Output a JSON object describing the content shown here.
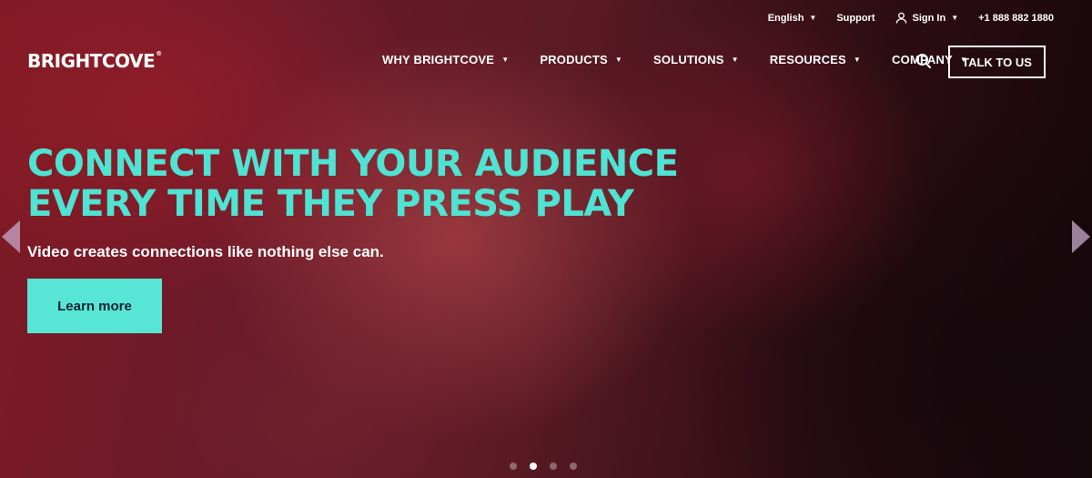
{
  "utility": {
    "language": "English",
    "support": "Support",
    "sign_in": "Sign In",
    "phone": "+1 888 882 1880"
  },
  "logo": {
    "text": "BRIGHTCOVE",
    "mark": "®"
  },
  "nav": {
    "items": [
      {
        "label": "WHY BRIGHTCOVE"
      },
      {
        "label": "PRODUCTS"
      },
      {
        "label": "SOLUTIONS"
      },
      {
        "label": "RESOURCES"
      },
      {
        "label": "COMPANY"
      }
    ],
    "cta": "TALK TO US",
    "search_icon": "search-icon"
  },
  "hero": {
    "headline_line1": "CONNECT WITH YOUR AUDIENCE",
    "headline_line2": "EVERY TIME THEY PRESS PLAY",
    "subhead": "Video creates connections like nothing else can.",
    "button": "Learn more",
    "slides": 4,
    "active_slide": 2
  },
  "colors": {
    "accent": "#4ee3d2",
    "button": "#57e6d5",
    "button_text": "#0b2330"
  }
}
